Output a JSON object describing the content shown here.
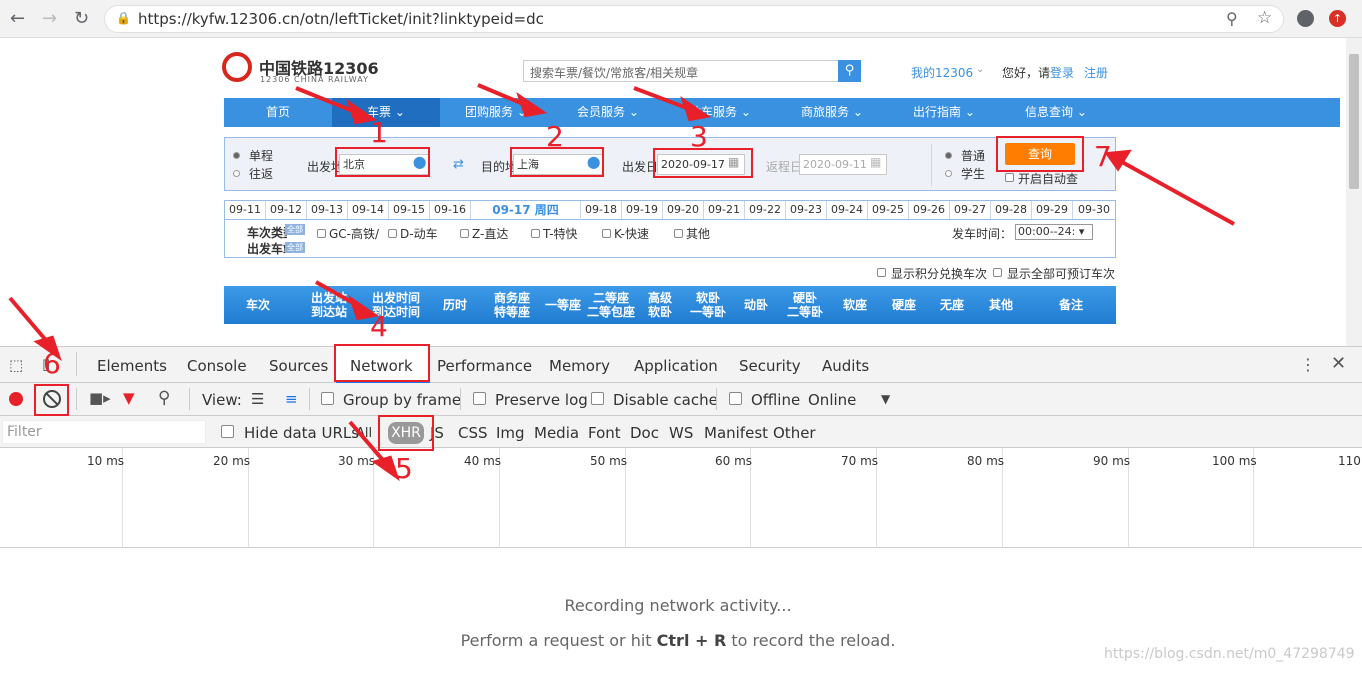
{
  "browser": {
    "url": "https://kyfw.12306.cn/otn/leftTicket/init?linktypeid=dc"
  },
  "site": {
    "logo_cn": "中国铁路12306",
    "logo_en": "12306 CHINA RAILWAY",
    "search_placeholder": "搜索车票/餐饮/常旅客/相关规章",
    "my12306": "我的12306",
    "hello": "您好，请",
    "login": "登录",
    "register": "注册",
    "menu": [
      "首页",
      "车票",
      "团购服务",
      "会员服务",
      "站车服务",
      "商旅服务",
      "出行指南",
      "信息查询"
    ],
    "trip": {
      "oneway": "单程",
      "round": "往返",
      "from_label": "出发地",
      "from": "北京",
      "to_label": "目的地",
      "to": "上海",
      "date_label": "出发日",
      "date": "2020-09-17",
      "return_label": "返程日",
      "return_date": "2020-09-11",
      "normal": "普通",
      "student": "学生",
      "query": "查询",
      "auto": "开启自动查"
    },
    "dates": [
      "09-11",
      "09-12",
      "09-13",
      "09-14",
      "09-15",
      "09-16",
      "09-17 周四",
      "09-18",
      "09-19",
      "09-20",
      "09-21",
      "09-22",
      "09-23",
      "09-24",
      "09-25",
      "09-26",
      "09-27",
      "09-28",
      "09-29",
      "09-30"
    ],
    "filter": {
      "type_label": "车次类型",
      "all": "全部",
      "gc": "GC-高铁/",
      "d": "D-动车",
      "z": "Z-直达",
      "t": "T-特快",
      "k": "K-快速",
      "other": "其他",
      "depart_label": "出发车站",
      "time_label": "发车时间：",
      "time_value": "00:00--24:"
    },
    "options": {
      "points": "显示积分兑换车次",
      "all_book": "显示全部可预订车次"
    },
    "headers": [
      "车次",
      "出发站\n到达站",
      "出发时间\n到达时间",
      "历时",
      "商务座\n特等座",
      "一等座",
      "二等座\n二等包座",
      "高级\n软卧",
      "软卧\n一等卧",
      "动卧",
      "硬卧\n二等卧",
      "软座",
      "硬座",
      "无座",
      "其他",
      "备注"
    ]
  },
  "devtools": {
    "tabs": [
      "Elements",
      "Console",
      "Sources",
      "Network",
      "Performance",
      "Memory",
      "Application",
      "Security",
      "Audits"
    ],
    "toolbar": {
      "view": "View:",
      "group": "Group by frame",
      "preserve": "Preserve log",
      "disable_cache": "Disable cache",
      "offline": "Offline",
      "online": "Online"
    },
    "filter_placeholder": "Filter",
    "hide_urls": "Hide data URLs",
    "types": [
      "All",
      "XHR",
      "JS",
      "CSS",
      "Img",
      "Media",
      "Font",
      "Doc",
      "WS",
      "Manifest",
      "Other"
    ],
    "ticks": [
      "10 ms",
      "20 ms",
      "30 ms",
      "40 ms",
      "50 ms",
      "60 ms",
      "70 ms",
      "80 ms",
      "90 ms",
      "100 ms",
      "110"
    ],
    "msg1": "Recording network activity...",
    "msg2_a": "Perform a request or hit ",
    "msg2_key": "Ctrl + R",
    "msg2_b": " to record the reload."
  },
  "annotations": [
    "1",
    "2",
    "3",
    "4",
    "5",
    "6",
    "7"
  ],
  "watermark": "https://blog.csdn.net/m0_47298749",
  "colors": {
    "menu": "#3a91e0",
    "accent": "#e8202a",
    "query": "#ff7d00"
  }
}
